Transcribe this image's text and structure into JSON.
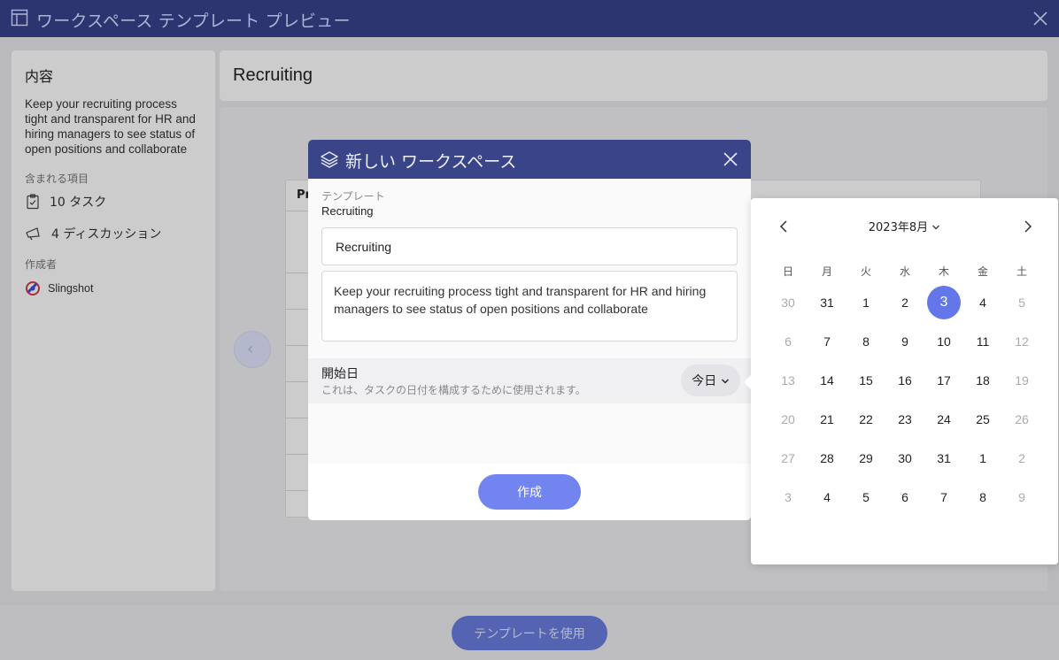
{
  "window": {
    "title": "ワークスペース テンプレート プレビュー"
  },
  "left_panel": {
    "heading": "内容",
    "description": "Keep your recruiting process tight and transparent for HR and hiring managers to see status of open positions and collaborate",
    "included_label": "含まれる項目",
    "tasks": "10 タスク",
    "discussions": "4 ディスカッション",
    "author_label": "作成者",
    "author": "Slingshot"
  },
  "header": {
    "title": "Recruiting"
  },
  "preview": {
    "column_head": "Pr"
  },
  "use_template_button": "テンプレートを使用",
  "modal": {
    "title": "新しい ワークスペース",
    "template_label": "テンプレート",
    "template_value": "Recruiting",
    "name_value": "Recruiting",
    "description_value": "Keep your recruiting process tight and transparent for HR and hiring managers to see status of open positions and collaborate",
    "start_date_label": "開始日",
    "start_date_hint": "これは、タスクの日付を構成するために使用されます。",
    "today_button": "今日",
    "create_button": "作成"
  },
  "calendar": {
    "month_label": "2023年8月",
    "weekdays": [
      "日",
      "月",
      "火",
      "水",
      "木",
      "金",
      "土"
    ],
    "weeks": [
      [
        "30",
        "31",
        "1",
        "2",
        "3",
        "4",
        "5"
      ],
      [
        "6",
        "7",
        "8",
        "9",
        "10",
        "11",
        "12"
      ],
      [
        "13",
        "14",
        "15",
        "16",
        "17",
        "18",
        "19"
      ],
      [
        "20",
        "21",
        "22",
        "23",
        "24",
        "25",
        "26"
      ],
      [
        "27",
        "28",
        "29",
        "30",
        "31",
        "1",
        "2"
      ],
      [
        "3",
        "4",
        "5",
        "6",
        "7",
        "8",
        "9"
      ]
    ],
    "selected": "3",
    "accent_color": "#6377e8"
  },
  "colors": {
    "title_bar": "#2c3570",
    "modal_header": "#3a4488",
    "primary_button": "#7284f0"
  },
  "icons": {
    "window": "window-layout-icon",
    "close": "close-icon",
    "tasks": "checklist-icon",
    "discussions": "megaphone-icon",
    "author": "slingshot-logo",
    "modal": "layers-icon",
    "today_dropdown": "chevron-down-icon",
    "prev": "chevron-left-icon",
    "next": "chevron-right-icon"
  }
}
